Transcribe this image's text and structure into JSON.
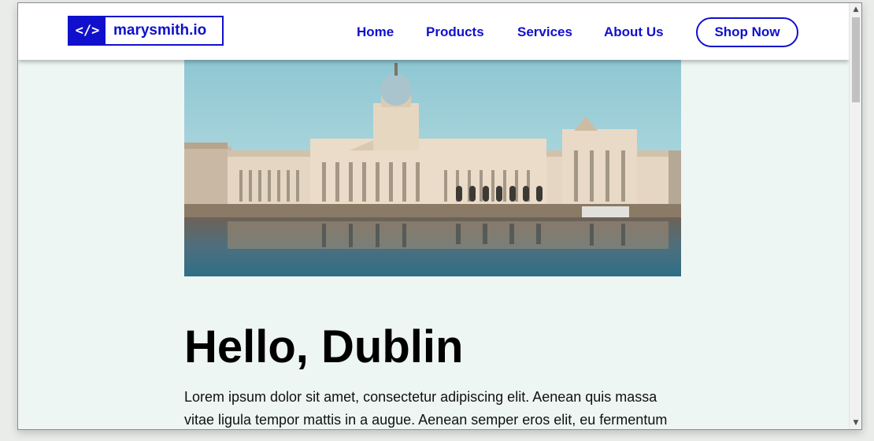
{
  "logo": {
    "mark": "</>",
    "text": "marysmith.io"
  },
  "nav": {
    "home": "Home",
    "products": "Products",
    "services": "Services",
    "about": "About Us",
    "cta": "Shop Now"
  },
  "hero": {
    "alt": "Custom House building reflected in the River Liffey, Dublin"
  },
  "content": {
    "heading": "Hello, Dublin",
    "paragraph": "Lorem ipsum dolor sit amet, consectetur adipiscing elit. Aenean quis massa vitae ligula tempor mattis in a augue. Aenean semper eros elit, eu fermentum"
  },
  "colors": {
    "brand": "#1010cc",
    "page_bg": "#eef6f3"
  },
  "icons": {
    "scroll_up": "chevron-up-icon",
    "scroll_down": "chevron-down-icon"
  }
}
